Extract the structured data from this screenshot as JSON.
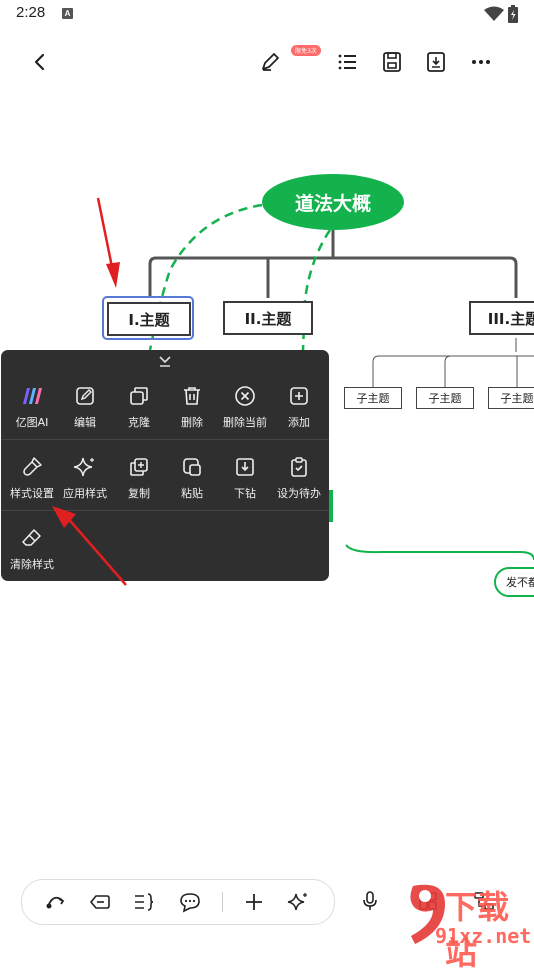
{
  "status_bar": {
    "time": "2:28",
    "notif_icon": "A"
  },
  "toolbar": {
    "back_icon": "back-arrow-icon",
    "badge": "限免3次",
    "icons": [
      "pen-icon",
      "list-icon",
      "save-icon",
      "download-icon",
      "more-icon"
    ]
  },
  "mindmap": {
    "root": "道法大概",
    "topics": [
      "I.主题",
      "II.主题",
      "III.主题"
    ],
    "subtopics": [
      "子主题",
      "子主题",
      "子主题"
    ],
    "partial_topic": "发不都"
  },
  "context_menu": {
    "rows": [
      [
        {
          "label": "亿图AI",
          "icon": "edraw-ai-icon"
        },
        {
          "label": "编辑",
          "icon": "edit-icon"
        },
        {
          "label": "克隆",
          "icon": "clone-icon"
        },
        {
          "label": "删除",
          "icon": "trash-icon"
        },
        {
          "label": "删除当前",
          "icon": "delete-current-icon"
        },
        {
          "label": "添加",
          "icon": "add-icon"
        }
      ],
      [
        {
          "label": "样式设置",
          "icon": "style-brush-icon"
        },
        {
          "label": "应用样式",
          "icon": "sparkle-icon"
        },
        {
          "label": "复制",
          "icon": "copy-icon"
        },
        {
          "label": "粘贴",
          "icon": "paste-icon"
        },
        {
          "label": "下钻",
          "icon": "drill-down-icon"
        },
        {
          "label": "设为待办",
          "icon": "todo-icon"
        }
      ],
      [
        {
          "label": "清除样式",
          "icon": "clear-style-icon"
        }
      ]
    ]
  },
  "bottom_bar": {
    "icons": [
      "curve-connector-icon",
      "label-icon",
      "summary-icon",
      "comment-icon",
      "plus-icon",
      "ai-sparkle-icon",
      "mic-icon",
      "layout-icon",
      "structure-icon"
    ]
  },
  "watermark": {
    "brand": "下载站",
    "domain": "91xz.net"
  },
  "colors": {
    "green": "#13b24d",
    "menu_bg": "#2f2f2f",
    "selection_blue": "#5a78d8",
    "arrow_red": "#e02020"
  }
}
